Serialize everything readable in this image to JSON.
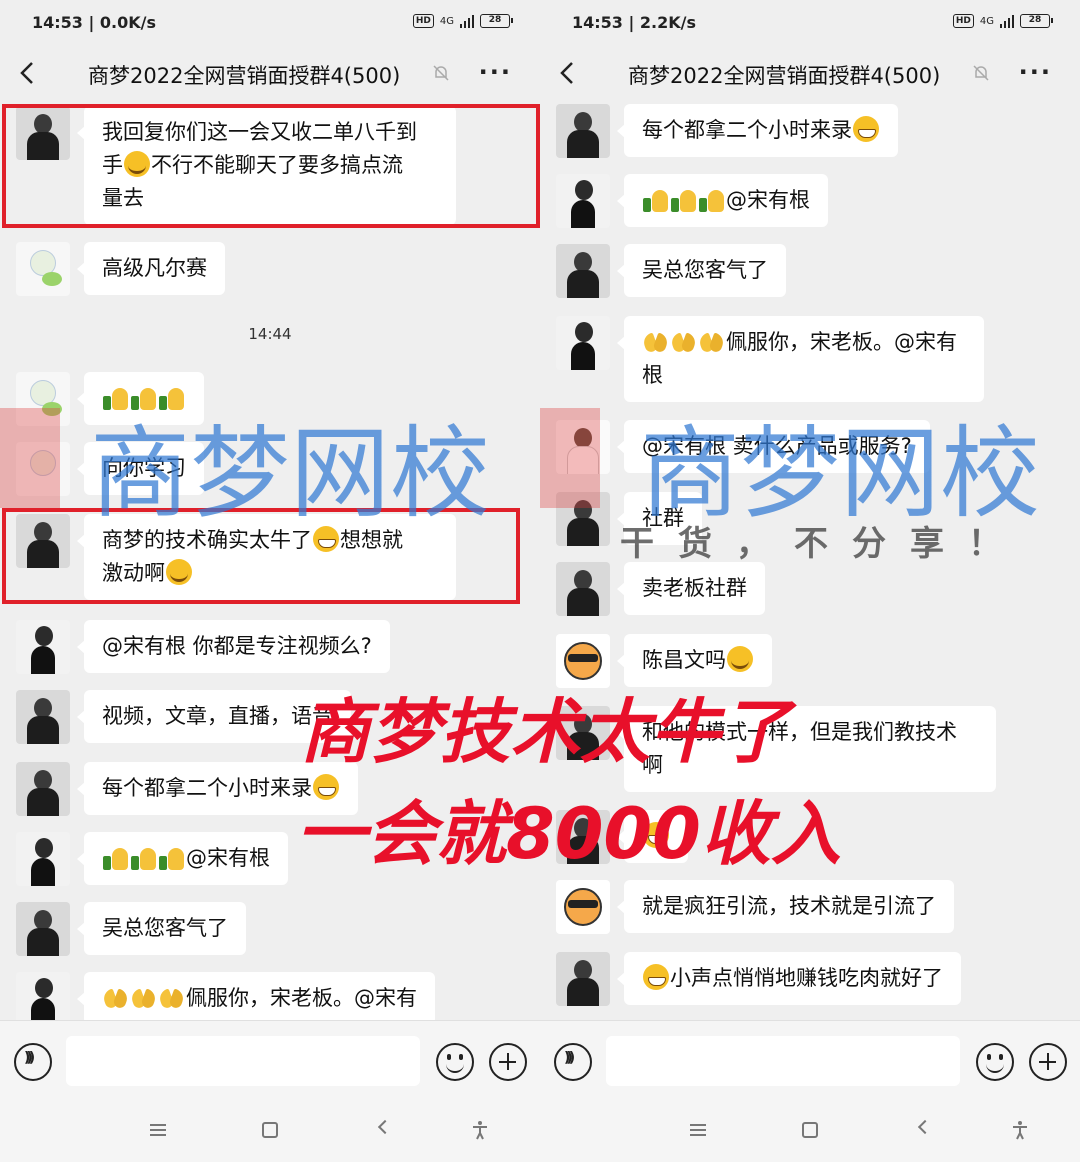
{
  "left": {
    "status": {
      "time": "14:53 | 0.0K/s",
      "network": "4G",
      "battery": "28"
    },
    "title": "商梦2022全网营销面授群4(500)",
    "messages": [
      {
        "text_a": "我回复你们这一会又收二单八千到",
        "text_b": "手",
        "text_c": "不行不能聊天了要多搞点流",
        "text_d": "量去"
      },
      {
        "text": "高级凡尔赛"
      },
      {
        "text": "向你学习"
      },
      {
        "text_a": "商梦的技术确实太牛了",
        "text_b": "想想就",
        "text_c": "激动啊"
      },
      {
        "text": "@宋有根  你都是专注视频么?"
      },
      {
        "text": "视频，文章，直播，语音"
      },
      {
        "text": "每个都拿二个小时来录"
      },
      {
        "text": "@宋有根"
      },
      {
        "text": "吴总您客气了"
      },
      {
        "text": "佩服你，宋老板。@宋有"
      }
    ],
    "timestamp": "14:44"
  },
  "right": {
    "status": {
      "time": "14:53 | 2.2K/s",
      "network": "4G",
      "battery": "28"
    },
    "title": "商梦2022全网营销面授群4(500)",
    "messages": [
      {
        "text": "每个都拿二个小时来录"
      },
      {
        "text": "@宋有根"
      },
      {
        "text": "吴总您客气了"
      },
      {
        "text_a": "佩服你，宋老板。@宋有",
        "text_b": "根"
      },
      {
        "text": "@宋有根  卖什么产品或服务?"
      },
      {
        "text": "社群"
      },
      {
        "text": "卖老板社群"
      },
      {
        "text": "陈昌文吗"
      },
      {
        "text_a": "和他的模式一样，但是我们教技术",
        "text_b": "啊"
      },
      {
        "text": ""
      },
      {
        "text": "就是疯狂引流，技术就是引流了"
      },
      {
        "text": "小声点悄悄地赚钱吃肉就好了"
      }
    ]
  },
  "overlay": {
    "line1": "商梦技术太牛了",
    "line2": "一会就8000收入"
  },
  "watermark": {
    "main": "商梦网校",
    "sub": "干货，不分享！"
  },
  "colors": {
    "highlight": "#e0202a",
    "overlay": "#e8102a",
    "watermark": "#3078d2"
  }
}
